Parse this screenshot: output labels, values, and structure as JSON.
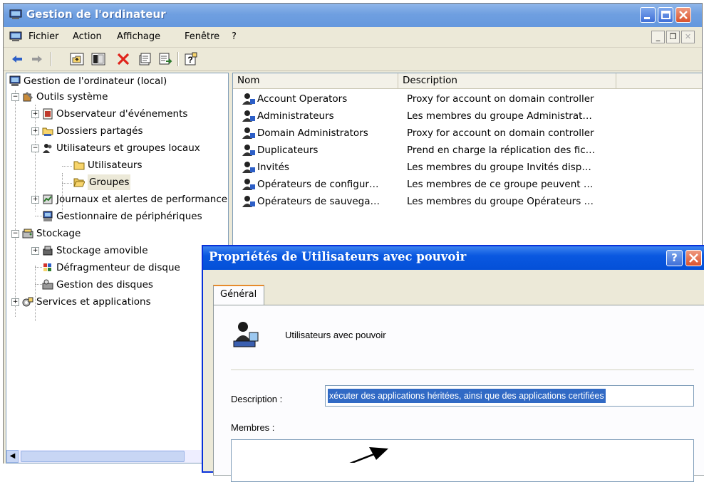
{
  "window": {
    "title": "Gestion de l'ordinateur",
    "colors": {
      "titlebar": "#6f9fe0",
      "dialog_titlebar": "#0a58e0",
      "close": "#d9532d"
    }
  },
  "menubar": {
    "items": [
      {
        "label": "Fichier"
      },
      {
        "label": "Action"
      },
      {
        "label": "Affichage"
      },
      {
        "label": "Fenêtre"
      },
      {
        "label": "?"
      }
    ]
  },
  "toolbar": {
    "buttons": [
      "back-arrow-icon",
      "forward-arrow-icon",
      "up-folder-icon",
      "show-hide-tree-icon",
      "delete-icon",
      "properties-icon",
      "export-list-icon",
      "help-icon"
    ]
  },
  "tree": {
    "items": [
      {
        "label": "Gestion de l'ordinateur (local)"
      },
      {
        "label": "Outils système"
      },
      {
        "label": "Observateur d'événements"
      },
      {
        "label": "Dossiers partagés"
      },
      {
        "label": "Utilisateurs et groupes locaux"
      },
      {
        "label": "Utilisateurs"
      },
      {
        "label": "Groupes"
      },
      {
        "label": "Journaux et alertes de performance"
      },
      {
        "label": "Gestionnaire de périphériques"
      },
      {
        "label": "Stockage"
      },
      {
        "label": "Stockage amovible"
      },
      {
        "label": "Défragmenteur de disque"
      },
      {
        "label": "Gestion des disques"
      },
      {
        "label": "Services et applications"
      }
    ]
  },
  "list": {
    "columns": [
      "Nom",
      "Description"
    ],
    "rows": [
      {
        "name": "Account Operators",
        "description": "Proxy for account on domain controller"
      },
      {
        "name": "Administrateurs",
        "description": "Les membres du groupe Administrat…"
      },
      {
        "name": "Domain Administrators",
        "description": "Proxy for account on domain controller"
      },
      {
        "name": "Duplicateurs",
        "description": "Prend en charge la réplication des fic…"
      },
      {
        "name": "Invités",
        "description": "Les membres du groupe Invités disp…"
      },
      {
        "name": "Opérateurs de configur…",
        "description": "Les membres de ce groupe peuvent …"
      },
      {
        "name": "Opérateurs de sauvega…",
        "description": "Les membres du groupe Opérateurs …"
      }
    ]
  },
  "dialog": {
    "title": "Propriétés de Utilisateurs avec pouvoir",
    "help_label": "?",
    "tab_label": "Général",
    "group_name": "Utilisateurs avec pouvoir",
    "description_label": "Description :",
    "description_value": "xécuter des applications héritées, ainsi que des applications certifiées",
    "members_label": "Membres :"
  }
}
